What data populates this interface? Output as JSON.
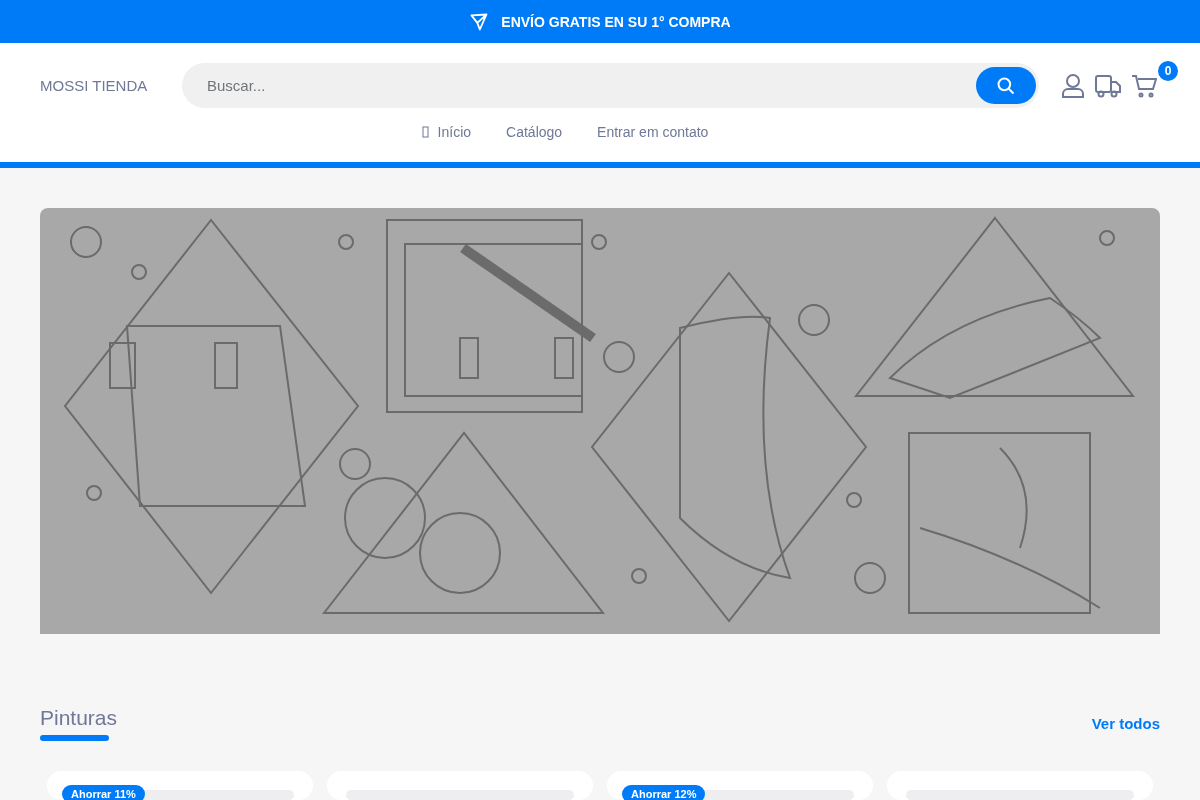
{
  "promo_bar": {
    "text": "ENVÍO GRATIS EN SU 1° COMPRA"
  },
  "header": {
    "logo": "MOSSI TIENDA",
    "search": {
      "placeholder": "Buscar..."
    },
    "cart_count": "0"
  },
  "nav": [
    {
      "label": "Início",
      "kind": "home"
    },
    {
      "label": "Catálogo",
      "kind": "plain"
    },
    {
      "label": "Entrar em contato",
      "kind": "plain"
    }
  ],
  "section": {
    "title": "Pinturas",
    "link": "Ver todos"
  },
  "products": [
    {
      "kind": "sale",
      "badge": "Ahorrar 11%"
    },
    {
      "kind": "regular"
    },
    {
      "kind": "sale",
      "badge": "Ahorrar 12%"
    },
    {
      "kind": "regular"
    }
  ]
}
